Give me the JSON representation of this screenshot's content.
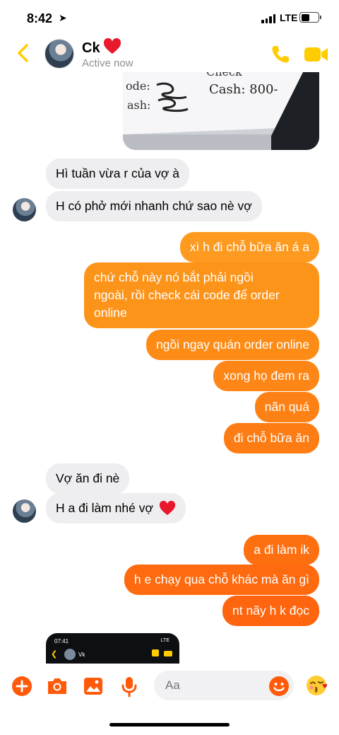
{
  "status_bar": {
    "time": "8:42",
    "network": "LTE",
    "battery_level": 0.4
  },
  "header": {
    "name": "Ck",
    "status": "Active now",
    "icons": [
      "back-icon",
      "phone-icon",
      "video-camera-icon"
    ],
    "accent": "#ffcc00"
  },
  "photo": {
    "text_line1": "Check",
    "text_line2": "Cash: 800-",
    "text_line3": "ode:",
    "text_line4": "ash:"
  },
  "messages": [
    {
      "side": "in",
      "text": "Hì tuần vừa r của vợ à"
    },
    {
      "side": "in",
      "text": "H có phở mới nhanh chứ sao nè vợ"
    },
    {
      "side": "out",
      "text": "xì h đi chỗ bữa ăn á a",
      "color": "#fd9a1f"
    },
    {
      "side": "out",
      "text_lines": [
        "chứ chỗ này nó bắt phải ngồi",
        "ngoài, rồi check cái code để order",
        "online"
      ],
      "color": "#fd941a"
    },
    {
      "side": "out",
      "text": "ngồi ngay quán order online",
      "color": "#fd8c17"
    },
    {
      "side": "out",
      "text": "xong họ đem ra",
      "color": "#fd8616"
    },
    {
      "side": "out",
      "text": "nãn quá",
      "color": "#fd8114"
    },
    {
      "side": "out",
      "text": "đi chỗ bữa ăn",
      "color": "#fd7c13"
    },
    {
      "side": "in",
      "text": "Vợ ăn đi nè"
    },
    {
      "side": "in",
      "text": "H a đi làm nhé vợ"
    },
    {
      "side": "out",
      "text": "a đi làm ik",
      "color": "#fe6f10"
    },
    {
      "side": "out",
      "text": "h e chạy qua chỗ khác mà ăn gì",
      "color": "#fe6a0f"
    },
    {
      "side": "out",
      "text": "nt nãy h k đọc",
      "color": "#fe650e"
    }
  ],
  "screenshot_preview": {
    "time": "07:41",
    "network": "LTE",
    "name": "Vk"
  },
  "composer": {
    "placeholder": "Aa",
    "icons": [
      "plus-icon",
      "camera-icon",
      "gallery-icon",
      "microphone-icon",
      "smiley-icon",
      "kiss-emoji-icon"
    ],
    "accent": "#ff5a0a"
  }
}
